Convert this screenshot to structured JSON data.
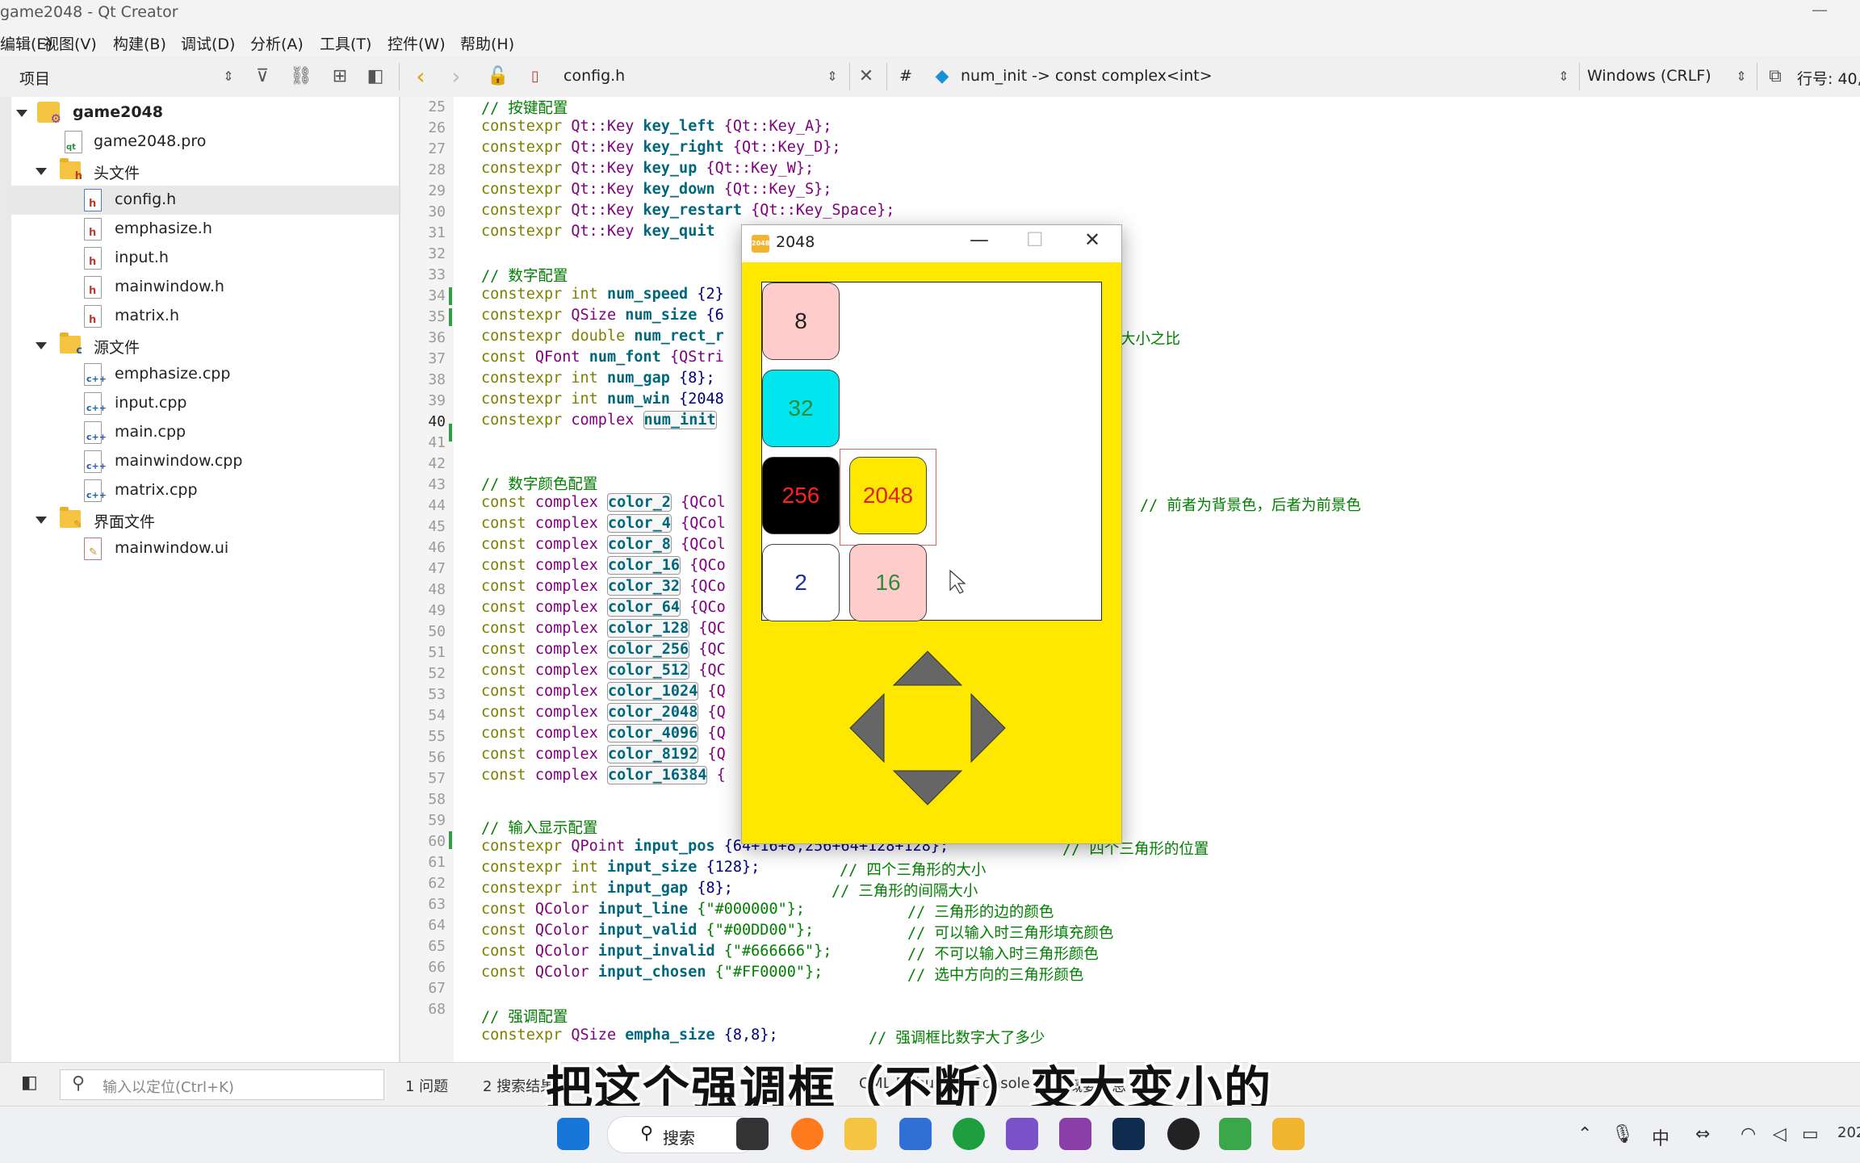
{
  "window": {
    "title": "game2048 - Qt Creator",
    "minimize": "—"
  },
  "menu": [
    "编辑(E)",
    "视图(V)",
    "构建(B)",
    "调试(D)",
    "分析(A)",
    "工具(T)",
    "控件(W)",
    "帮助(H)"
  ],
  "toolbar": {
    "project_label": "项目",
    "file_name": "config.h",
    "hash": "#",
    "symbol": "num_init -> const complex<int>",
    "encoding": "Windows (CRLF)",
    "position": "行号: 40,"
  },
  "tree": {
    "project": "game2048",
    "pro_file": "game2048.pro",
    "headers_label": "头文件",
    "headers": [
      "config.h",
      "emphasize.h",
      "input.h",
      "mainwindow.h",
      "matrix.h"
    ],
    "sources_label": "源文件",
    "sources": [
      "emphasize.cpp",
      "input.cpp",
      "main.cpp",
      "mainwindow.cpp",
      "matrix.cpp"
    ],
    "forms_label": "界面文件",
    "forms": [
      "mainwindow.ui"
    ]
  },
  "code": {
    "line_numbers": [
      "25",
      "26",
      "27",
      "28",
      "29",
      "30",
      "31",
      "32",
      "33",
      "34",
      "35",
      "36",
      "37",
      "38",
      "39",
      "40",
      "41",
      "42",
      "43",
      "44",
      "45",
      "46",
      "47",
      "48",
      "49",
      "50",
      "51",
      "52",
      "53",
      "54",
      "55",
      "56",
      "57",
      "58",
      "59",
      "60",
      "61",
      "62",
      "63",
      "64",
      "65",
      "66",
      "67",
      "68"
    ],
    "current_line": "40",
    "l25": "// 按键配置",
    "l26_id": "key_left",
    "l26_rest": "{Qt::Key_A};",
    "l27_id": "key_right",
    "l27_rest": "{Qt::Key_D};",
    "l28_id": "key_up",
    "l28_rest": "{Qt::Key_W};",
    "l29_id": "key_down",
    "l29_rest": "{Qt::Key_S};",
    "l30_id": "key_restart",
    "l30_rest": "{Qt::Key_Space};",
    "l31_id": "key_quit",
    "l33": "// 数字配置",
    "l34_id": "num_speed",
    "l34_rest": "{2}",
    "l35_id": "num_size",
    "l35_rest": "{6",
    "l36_id": "num_rect_r",
    "l36_cm": "大小之比",
    "l37_id": "num_font",
    "l37_rest": "{QStri",
    "l38_id": "num_gap",
    "l38_rest": "{8};",
    "l39_id": "num_win",
    "l39_rest": "{2048",
    "l40_id": "num_init",
    "l42": "// 数字颜色配置",
    "colors": [
      "color_2",
      "color_4",
      "color_8",
      "color_16",
      "color_32",
      "color_64",
      "color_128",
      "color_256",
      "color_512",
      "color_1024",
      "color_2048",
      "color_4096",
      "color_8192",
      "color_16384"
    ],
    "color_rest": [
      "{QCol",
      "{QCol",
      "{QCol",
      "{QCo",
      "{QCo",
      "{QCo",
      "{QC",
      "{QC",
      "{QC",
      "{Q",
      "{Q",
      "{Q",
      "{Q",
      "{"
    ],
    "l43_cm": "// 前者为背景色，后者为前景色",
    "l58": "// 输入显示配置",
    "l59_id": "input_pos",
    "l59_rest": "{64+16+8,256+64+128+128};",
    "l59_cm": "// 四个三角形的位置",
    "l60_id": "input_size",
    "l60_rest": "{128};",
    "l60_cm": "// 四个三角形的大小",
    "l61_id": "input_gap",
    "l61_rest": "{8};",
    "l61_cm": "// 三角形的间隔大小",
    "l62_id": "input_line",
    "l62_rest": "{\"#000000\"};",
    "l62_cm": "// 三角形的边的颜色",
    "l63_id": "input_valid",
    "l63_rest": "{\"#00DD00\"};",
    "l63_cm": "// 可以输入时三角形填充颜色",
    "l64_id": "input_invalid",
    "l64_rest": "{\"#666666\"};",
    "l64_cm": "// 不可以输入时三角形颜色",
    "l65_id": "input_chosen",
    "l65_rest": "{\"#FF0000\"};",
    "l65_cm": "// 选中方向的三角形颜色",
    "l67": "// 强调配置",
    "l68_id": "empha_size",
    "l68_rest": "{8,8};",
    "l68_cm": "// 强调框比数字大了多少"
  },
  "kw": {
    "constexpr": "constexpr",
    "const": "const",
    "qtkey": "Qt::Key",
    "int": "int",
    "qsize": "QSize",
    "double": "double",
    "qfont": "QFont",
    "complex": "complex",
    "qpoint": "QPoint",
    "qcolor": "QColor"
  },
  "game": {
    "title": "2048",
    "logo": "2048",
    "tiles": [
      {
        "value": "8",
        "bg": "#ffcccc",
        "fg": "#222222"
      },
      {
        "value": "32",
        "bg": "#00e5ee",
        "fg": "#2e8b3a"
      },
      {
        "value": "256",
        "bg": "#000000",
        "fg": "#ff2020"
      },
      {
        "value": "2048",
        "bg": "#ffe800",
        "fg": "#e02020"
      },
      {
        "value": "2",
        "bg": "#ffffff",
        "fg": "#1a2fa0"
      },
      {
        "value": "16",
        "bg": "#ffcccc",
        "fg": "#2e8b3a"
      }
    ],
    "board_bg": "#ffffff",
    "window_bg": "#ffe800",
    "triangle_color": "#666666"
  },
  "status": {
    "locator_placeholder": "输入以定位(Ctrl+K)",
    "items": [
      "1  问题",
      "2  搜索结果",
      "QML Debugger Console",
      "6 概要信息"
    ]
  },
  "subtitle": "把这个强调框（不断）变大变小的",
  "taskbar": {
    "search": "搜索",
    "clock": "202"
  }
}
